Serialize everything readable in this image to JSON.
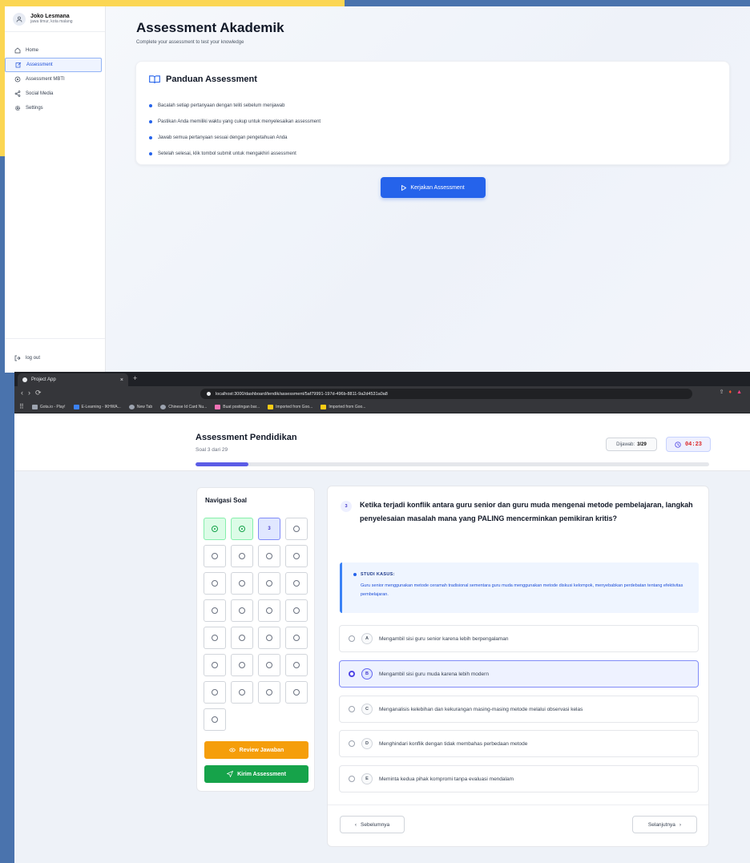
{
  "top": {
    "user": {
      "name": "Joko Lesmana",
      "location": "jawa timur, kota malang"
    },
    "nav": [
      {
        "label": "Home",
        "icon": "home-icon",
        "active": false
      },
      {
        "label": "Assessment",
        "icon": "edit-icon",
        "active": true
      },
      {
        "label": "Assessment MBTI",
        "icon": "mbti-icon",
        "active": false
      },
      {
        "label": "Social Media",
        "icon": "share-icon",
        "active": false
      },
      {
        "label": "Settings",
        "icon": "gear-icon",
        "active": false
      }
    ],
    "logout_label": "log out",
    "title": "Assessment Akademik",
    "subtitle": "Complete your assessment to test your knowledge",
    "guide": {
      "title": "Panduan Assessment",
      "items": [
        "Bacalah setiap pertanyaan dengan teliti sebelum menjawab",
        "Pastikan Anda memiliki waktu yang cukup untuk menyelesaikan assessment",
        "Jawab semua pertanyaan sesuai dengan pengetahuan Anda",
        "Setelah selesai, klik tombol submit untuk mengakhiri assessment"
      ]
    },
    "start_button": "Kerjakan Assessment"
  },
  "browser": {
    "tab_title": "Project App",
    "url": "localhost:3000/dashboard/tendik/assessment/5af79991-197d-496b-8811-9a2d4531a0a8",
    "bookmarks": [
      {
        "label": "Gota.io - Play!",
        "color": "#9ca3af"
      },
      {
        "label": "E-Learning - IKHWA...",
        "color": "#3b82f6"
      },
      {
        "label": "New Tab",
        "color": "#9ca3af"
      },
      {
        "label": "Chinese Id Card Nu...",
        "color": "#9ca3af"
      },
      {
        "label": "Buat postingan bar...",
        "color": "#f472b6"
      },
      {
        "label": "Imported from Goo...",
        "color": "#facc15"
      },
      {
        "label": "Imported from Goo...",
        "color": "#facc15"
      }
    ]
  },
  "assessment": {
    "title": "Assessment Pendidikan",
    "subtitle": "Soal 3 dari 29",
    "answered_label": "Dijawab:",
    "answered_value": "3/29",
    "timer": "04:23",
    "progress_fraction": 0.103,
    "nav_title": "Navigasi Soal",
    "current_number": "3",
    "question_statuses": [
      "done",
      "done",
      "current",
      "todo",
      "todo",
      "todo",
      "todo",
      "todo",
      "todo",
      "todo",
      "todo",
      "todo",
      "todo",
      "todo",
      "todo",
      "todo",
      "todo",
      "todo",
      "todo",
      "todo",
      "todo",
      "todo",
      "todo",
      "todo",
      "todo",
      "todo",
      "todo",
      "todo",
      "todo"
    ],
    "review_button": "Review Jawaban",
    "submit_button": "Kirim Assessment",
    "question_number": "3",
    "question_text": "Ketika terjadi konflik antara guru senior dan guru muda mengenai metode pembelajaran, langkah penyelesaian masalah mana yang PALING mencerminkan pemikiran kritis?",
    "case_label": "STUDI KASUS:",
    "case_text": "Guru senior menggunakan metode ceramah tradisional sementara guru muda menggunakan metode diskusi kelompok, menyebabkan perdebatan tentang efektivitas pembelajaran.",
    "options": [
      {
        "letter": "A",
        "text": "Mengambil sisi guru senior karena lebih berpengalaman",
        "selected": false
      },
      {
        "letter": "B",
        "text": "Mengambil sisi guru muda karena lebih modern",
        "selected": true
      },
      {
        "letter": "C",
        "text": "Menganalisis kelebihan dan kekurangan masing-masing metode melalui observasi kelas",
        "selected": false
      },
      {
        "letter": "D",
        "text": "Menghindari konflik dengan tidak membahas perbedaan metode",
        "selected": false
      },
      {
        "letter": "E",
        "text": "Meminta kedua pihak kompromi tanpa evaluasi mendalam",
        "selected": false
      }
    ],
    "prev_button": "Sebelumnya",
    "next_button": "Selanjutnya"
  }
}
